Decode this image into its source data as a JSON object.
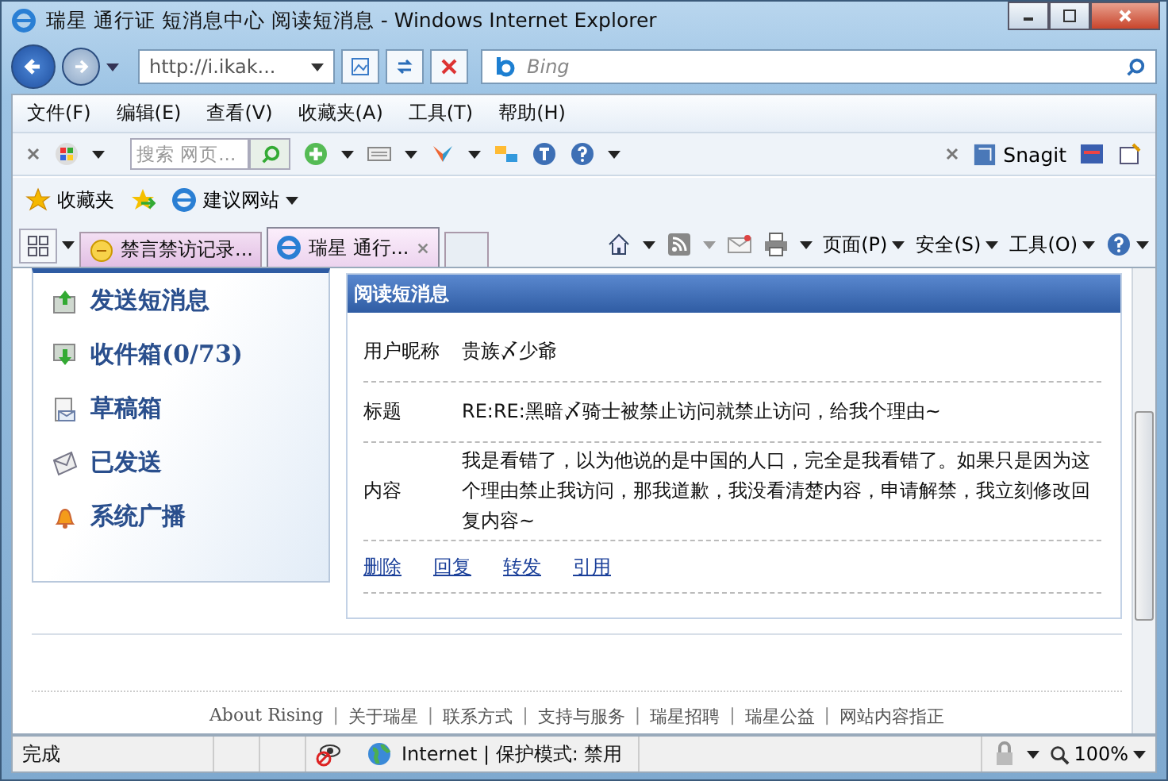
{
  "window": {
    "title": "瑞星 通行证 短消息中心 阅读短消息 - Windows Internet Explorer"
  },
  "address_bar": {
    "url": "http://i.ikak...",
    "search_placeholder": "Bing"
  },
  "menu": [
    "文件(F)",
    "编辑(E)",
    "查看(V)",
    "收藏夹(A)",
    "工具(T)",
    "帮助(H)"
  ],
  "toolbar": {
    "search_placeholder": "搜索 网页...",
    "snagit": "Snagit"
  },
  "favorites_bar": {
    "favorites": "收藏夹",
    "suggested": "建议网站"
  },
  "tabs": [
    {
      "label": "禁言禁访记录...",
      "selected": false
    },
    {
      "label": "瑞星 通行...",
      "selected": true
    }
  ],
  "command_bar": [
    "页面(P)",
    "安全(S)",
    "工具(O)"
  ],
  "sidebar": {
    "items": [
      {
        "label": "发送短消息"
      },
      {
        "label": "收件箱(0/73)"
      },
      {
        "label": "草稿箱"
      },
      {
        "label": "已发送"
      },
      {
        "label": "系统广播"
      }
    ]
  },
  "message": {
    "heading": "阅读短消息",
    "fields": [
      {
        "label": "用户昵称",
        "value": "贵族〆少爺"
      },
      {
        "label": "标题",
        "value": "RE:RE:黑暗〆骑士被禁止访问就禁止访问，给我个理由~"
      },
      {
        "label": "内容",
        "value": "我是看错了，以为他说的是中国的人口，完全是我看错了。如果只是因为这个理由禁止我访问，那我道歉，我没看清楚内容，申请解禁，我立刻修改回复内容~"
      }
    ],
    "actions": [
      "删除",
      "回复",
      "转发",
      "引用"
    ]
  },
  "footer_separator": "|",
  "footer_links": [
    "About  Rising",
    "关于瑞星",
    "联系方式",
    "支持与服务",
    "瑞星招聘",
    "瑞星公益",
    "网站内容指正"
  ],
  "status_bar": {
    "status": "完成",
    "zone": "Internet | 保护模式: 禁用",
    "zoom": "100%"
  }
}
